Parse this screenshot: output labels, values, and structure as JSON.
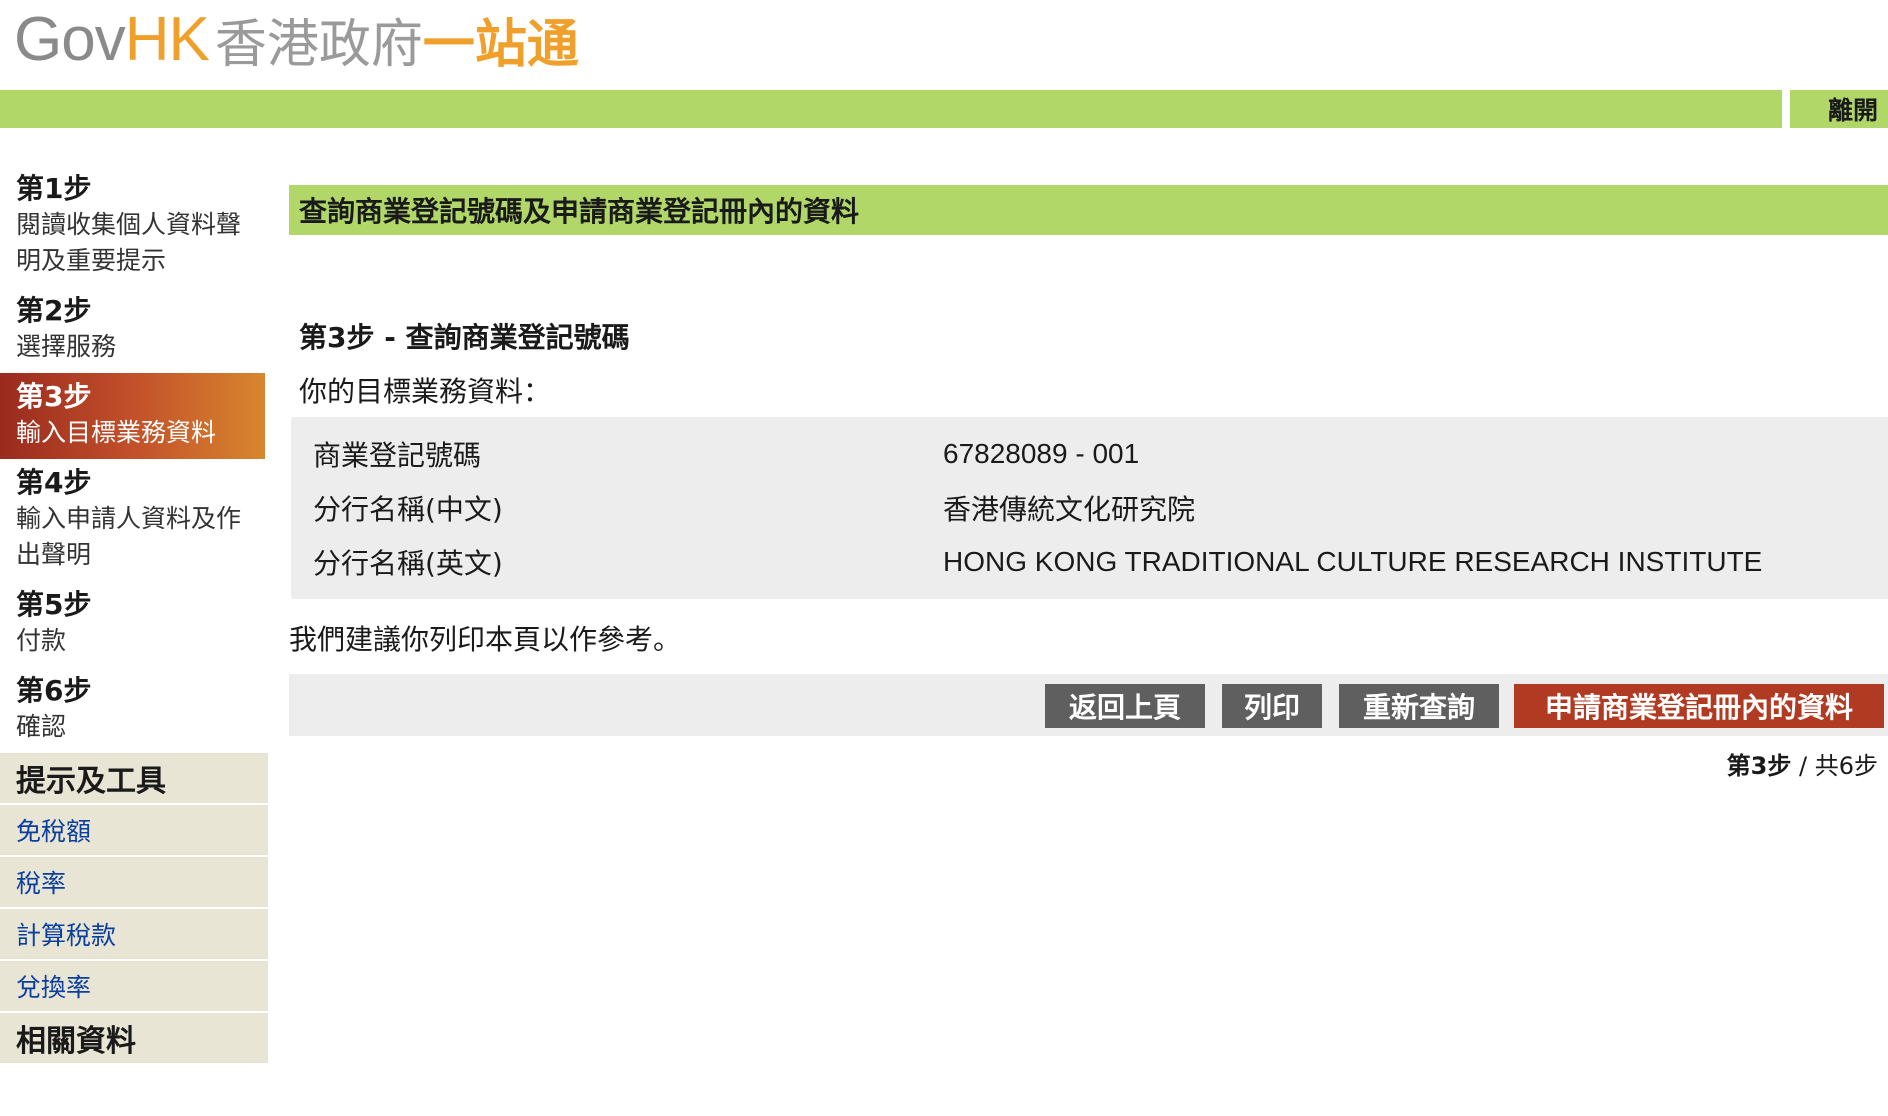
{
  "header": {
    "logo_gov": "Gov",
    "logo_hk": "HK",
    "logo_cn_gray": "香港政府",
    "logo_cn_orange": "一站通",
    "exit_label": "離開"
  },
  "sidebar": {
    "steps": [
      {
        "num": "第1步",
        "desc_line1": "閱讀收集個人資料聲",
        "desc_line2": "明及重要提示"
      },
      {
        "num": "第2步",
        "desc_line1": "選擇服務"
      },
      {
        "num": "第3步",
        "desc_line1": "輸入目標業務資料"
      },
      {
        "num": "第4步",
        "desc_line1": "輸入申請人資料及作",
        "desc_line2": "出聲明"
      },
      {
        "num": "第5步",
        "desc_line1": "付款"
      },
      {
        "num": "第6步",
        "desc_line1": "確認"
      }
    ],
    "tools_heading": "提示及工具",
    "tools": [
      "免稅額",
      "稅率",
      "計算稅款",
      "兌換率"
    ],
    "related_heading": "相關資料"
  },
  "main": {
    "title": "查詢商業登記號碼及申請商業登記冊內的資料",
    "step_heading": "第3步 - 查詢商業登記號碼",
    "info_label": "你的目標業務資料：",
    "rows": [
      {
        "key": "商業登記號碼",
        "value": "67828089 - 001"
      },
      {
        "key": "分行名稱(中文)",
        "value": "香港傳統文化研究院"
      },
      {
        "key": "分行名稱(英文)",
        "value": "HONG KONG TRADITIONAL CULTURE RESEARCH INSTITUTE"
      }
    ],
    "suggest": "我們建議你列印本頁以作參考。",
    "buttons": {
      "back": "返回上頁",
      "print": "列印",
      "requery": "重新查詢",
      "apply": "申請商業登記冊內的資料"
    },
    "step_count_current": "第3步",
    "step_count_total": " / 共6步"
  },
  "colors": {
    "green_bar": "#b0d767",
    "active_step_start": "#9a2a1e",
    "active_step_end": "#d8862e",
    "button_gray": "#5f5f5f",
    "button_red": "#b03a22",
    "sidebar_tools_bg": "#e8e5d4",
    "link_blue": "#0a3fa0"
  }
}
